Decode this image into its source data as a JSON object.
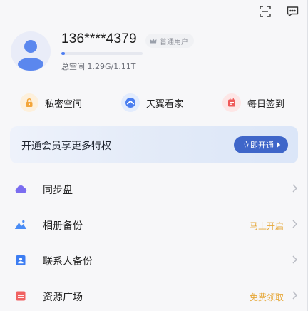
{
  "top_icons": [
    "scan-icon",
    "message-icon"
  ],
  "profile": {
    "phone": "136****4379",
    "badge": "普通用户",
    "storage_text": "总空间 1.29G/1.11T",
    "storage_fraction": 0.01
  },
  "quick": [
    {
      "label": "私密空间",
      "icon": "lock-icon",
      "color": "#f3a53a"
    },
    {
      "label": "天翼看家",
      "icon": "camera-icon",
      "color": "#4a7ef0"
    },
    {
      "label": "每日签到",
      "icon": "calendar-icon",
      "color": "#ef5a5a"
    }
  ],
  "vip": {
    "title": "开通会员享更多特权",
    "button": "立即开通"
  },
  "list": [
    {
      "label": "同步盘",
      "extra": "",
      "icon": "cloud-icon",
      "color": "#7b6df0"
    },
    {
      "label": "相册备份",
      "extra": "马上开启",
      "icon": "mountain-icon",
      "color": "#4a8cf5"
    },
    {
      "label": "联系人备份",
      "extra": "",
      "icon": "contact-icon",
      "color": "#3d7df2"
    },
    {
      "label": "资源广场",
      "extra": "免费领取",
      "icon": "gift-box-icon",
      "color": "#f06262"
    }
  ]
}
